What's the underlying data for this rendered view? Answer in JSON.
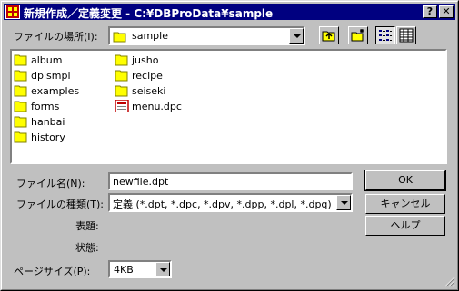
{
  "window": {
    "title": "新規作成／定義変更 - C:¥DBProData¥sample",
    "help_button": "?",
    "close_button": "✕"
  },
  "location": {
    "label": "ファイルの場所(I):",
    "value": "sample"
  },
  "toolbar": {
    "up_icon": "up-folder-icon",
    "new_folder_icon": "new-folder-icon",
    "list_view_icon": "list-view-icon",
    "details_view_icon": "details-view-icon"
  },
  "files": [
    {
      "name": "album",
      "type": "folder"
    },
    {
      "name": "dplsmpl",
      "type": "folder"
    },
    {
      "name": "examples",
      "type": "folder"
    },
    {
      "name": "forms",
      "type": "folder"
    },
    {
      "name": "hanbai",
      "type": "folder"
    },
    {
      "name": "history",
      "type": "folder"
    },
    {
      "name": "jusho",
      "type": "folder"
    },
    {
      "name": "recipe",
      "type": "folder"
    },
    {
      "name": "seiseki",
      "type": "folder"
    },
    {
      "name": "menu.dpc",
      "type": "file"
    }
  ],
  "form": {
    "filename_label": "ファイル名(N):",
    "filename_value": "newfile.dpt",
    "filetype_label": "ファイルの種類(T):",
    "filetype_value": "定義 (*.dpt, *.dpc, *.dpv, *.dpp, *.dpl, *.dpq)",
    "title_label": "表題:",
    "status_label": "状態:",
    "pagesize_label": "ページサイズ(P):",
    "pagesize_value": "4KB"
  },
  "buttons": {
    "ok": "OK",
    "cancel": "キャンセル",
    "help": "ヘルプ"
  },
  "colors": {
    "titlebar": "#000080",
    "face": "#c0c0c0",
    "folder": "#ffff00"
  }
}
